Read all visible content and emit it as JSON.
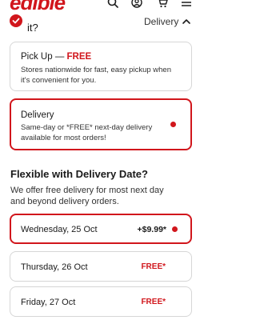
{
  "header": {
    "logo": "edible",
    "icons": [
      "search-icon",
      "account-icon",
      "cart-icon",
      "menu-icon"
    ]
  },
  "section": {
    "question": "it?",
    "value": "Delivery",
    "check_icon": "check-icon",
    "chevron_icon": "chevron-up-icon"
  },
  "options": {
    "pickup": {
      "title_prefix": "Pick Up — ",
      "title_free": "FREE",
      "description": "Stores nationwide for fast, easy pickup when it's convenient for you."
    },
    "delivery": {
      "title": "Delivery",
      "description": "Same-day or *FREE* next-day delivery available for most orders!"
    }
  },
  "flexible": {
    "title": "Flexible with Delivery Date?",
    "description": "We offer free delivery for most next day and beyond delivery orders."
  },
  "dates": [
    {
      "label": "Wednesday, 25 Oct",
      "price": "+$9.99*"
    },
    {
      "label": "Thursday, 26 Oct",
      "price": "FREE*"
    },
    {
      "label": "Friday, 27 Oct",
      "price": "FREE*"
    }
  ],
  "colors": {
    "accent": "#d1161c",
    "border": "#d6d6d6",
    "text": "#1a1a1a"
  }
}
